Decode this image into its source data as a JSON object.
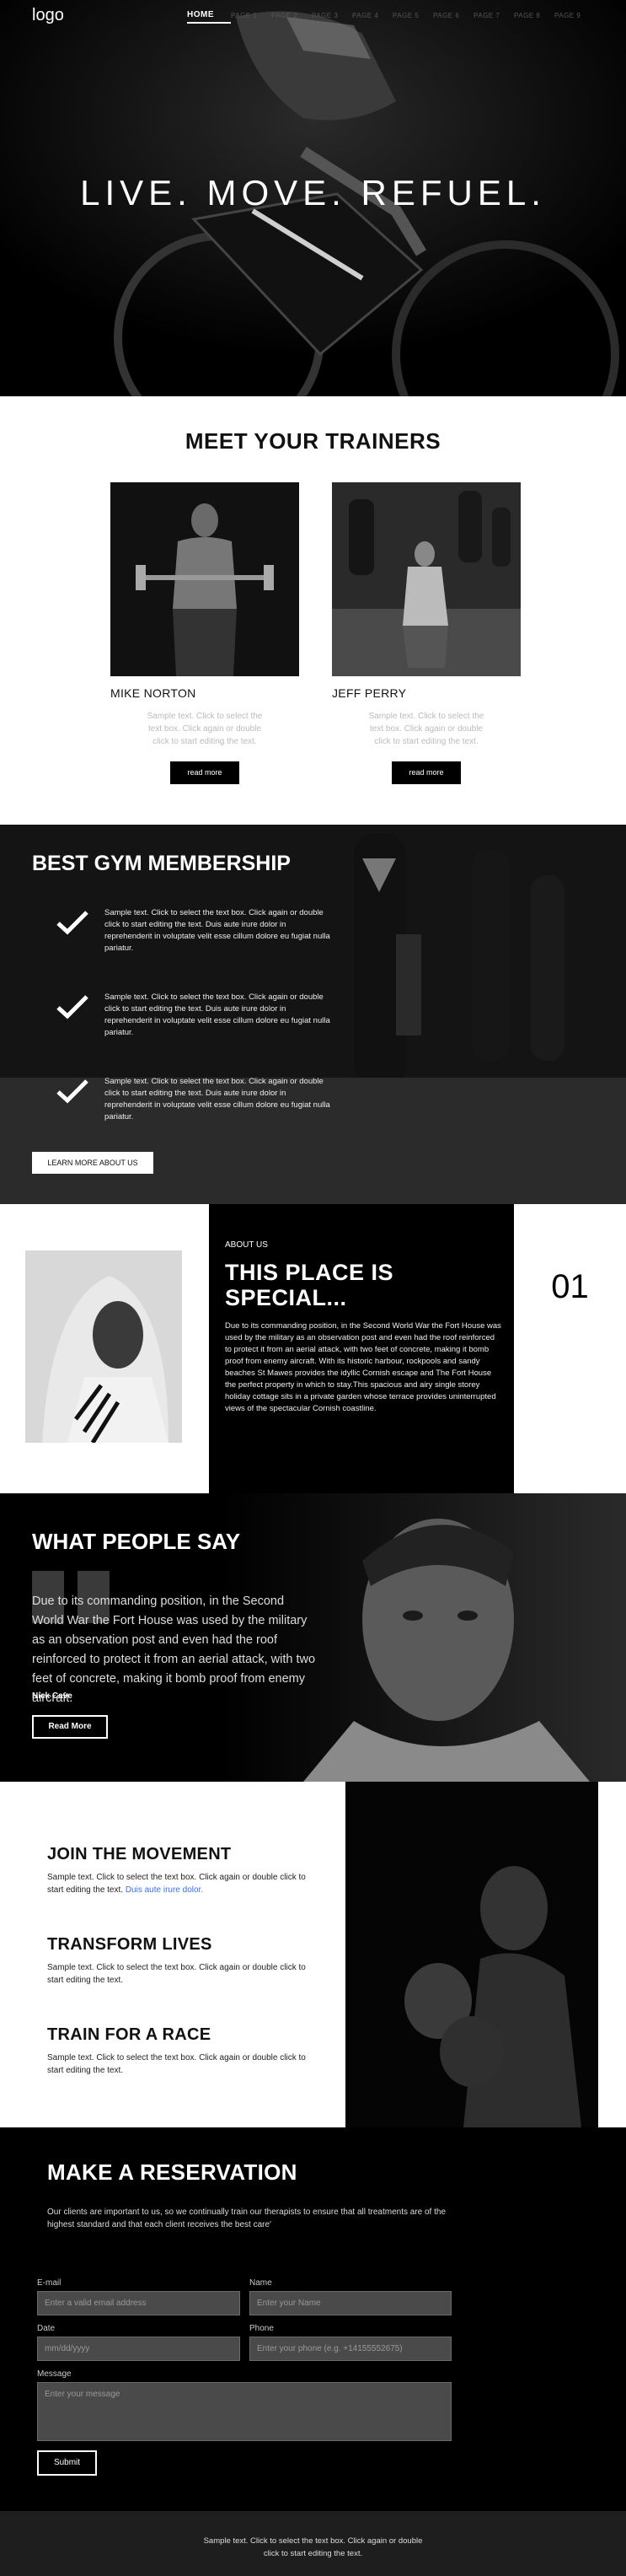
{
  "nav": {
    "logo": "logo",
    "links": [
      "HOME",
      "PAGE 1",
      "PAGE 2",
      "PAGE 3",
      "PAGE 4",
      "PAGE 5",
      "PAGE 6",
      "PAGE 7",
      "PAGE 8",
      "PAGE 9"
    ]
  },
  "hero": {
    "title": "LIVE. MOVE. REFUEL."
  },
  "trainers": {
    "title": "MEET YOUR TRAINERS",
    "items": [
      {
        "name": "MIKE NORTON",
        "desc": "Sample text. Click to select the text box. Click again or double click to start editing the text.",
        "button": "read more"
      },
      {
        "name": "JEFF PERRY",
        "desc": "Sample text. Click to select the text box. Click again or double click to start editing the text.",
        "button": "read more"
      }
    ]
  },
  "membership": {
    "title": "BEST GYM MEMBERSHIP",
    "items": [
      {
        "text": "Sample text. Click to select the text box. Click again or double click to start editing the text. Duis aute irure dolor in reprehenderit in voluptate velit esse cillum dolore eu fugiat nulla pariatur."
      },
      {
        "text": "Sample text. Click to select the text box. Click again or double click to start editing the text. Duis aute irure dolor in reprehenderit in voluptate velit esse cillum dolore eu fugiat nulla pariatur."
      },
      {
        "text": "Sample text. Click to select the text box. Click again or double click to start editing the text. Duis aute irure dolor in reprehenderit in voluptate velit esse cillum dolore eu fugiat nulla pariatur."
      }
    ],
    "button": "LEARN MORE ABOUT US"
  },
  "about": {
    "label": "ABOUT US",
    "title_line1": "THIS PLACE IS",
    "title_line2": "SPECIAL...",
    "body": "Due to its commanding position, in the Second World War the Fort House was used by the military as an observation post and even had the roof reinforced to protect it from an aerial attack, with two feet of concrete, making it bomb proof from enemy aircraft. With its historic harbour, rockpools and sandy beaches St Mawes provides the idyllic Cornish escape and The Fort House the perfect property in which to stay.This spacious and airy single storey holiday cottage sits in a private garden whose terrace provides uninterrupted views of the spectacular Cornish coastline.",
    "number": "01"
  },
  "testimonial": {
    "title": "WHAT PEOPLE SAY",
    "quote": "Due to its commanding position, in the Second World War the Fort House was used by the military as an observation post and even had the roof reinforced to protect it from an aerial attack, with two feet of concrete, making it bomb proof from enemy aircraft.",
    "author": "Nick Cave",
    "button": "Read More"
  },
  "features": {
    "items": [
      {
        "title": "JOIN THE MOVEMENT",
        "text": "Sample text. Click to select the text box. Click again or double click to start editing the text. ",
        "link": "Duis aute irure dolor."
      },
      {
        "title": "TRANSFORM LIVES",
        "text": "Sample text. Click to select the text box. Click again or double click to start editing the text.",
        "link": ""
      },
      {
        "title": "TRAIN FOR A RACE",
        "text": "Sample text. Click to select the text box. Click again or double click to start editing the text.",
        "link": ""
      }
    ]
  },
  "reservation": {
    "title": "MAKE A RESERVATION",
    "intro": "Our clients are important to us, so we continually train our therapists to ensure that all treatments are of the highest standard and that each client receives the best care'",
    "email": {
      "label": "E-mail",
      "placeholder": "Enter a valid email address"
    },
    "name": {
      "label": "Name",
      "placeholder": "Enter your Name"
    },
    "date": {
      "label": "Date",
      "placeholder": "mm/dd/yyyy"
    },
    "phone": {
      "label": "Phone",
      "placeholder": "Enter your phone (e.g. +14155552675)"
    },
    "message": {
      "label": "Message",
      "placeholder": "Enter your message"
    },
    "submit": "Submit"
  },
  "footer": {
    "line1": "Sample text. Click to select the text box. Click again or double",
    "line2": "click to start editing the text."
  },
  "colors": {
    "accent": "#000000",
    "link": "#3a6fd8",
    "panel": "#1b1b1b"
  }
}
